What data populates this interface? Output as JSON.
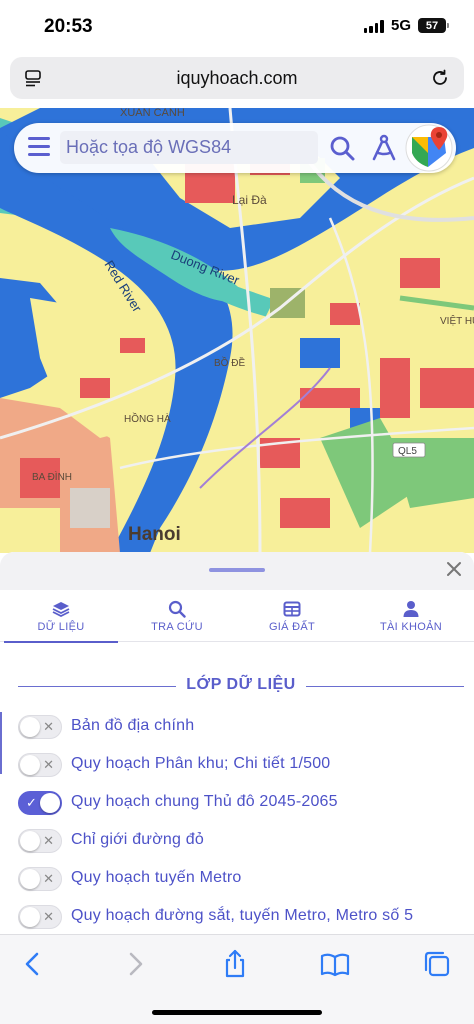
{
  "status_bar": {
    "time": "20:53",
    "network": "5G",
    "battery": "57",
    "signal_icon": "signal-bars-icon"
  },
  "browser": {
    "url": "iquyhoach.com",
    "left_icon": "page-menu-icon",
    "reload_icon": "reload-icon"
  },
  "map": {
    "labels": {
      "xuan_canh": "XUÂN CANH",
      "lai_da": "Lại Đà",
      "red_river": "Red River",
      "duong_river": "Duong River",
      "bo_de": "BỒ ĐỀ",
      "viet_hung": "VIỆT HƯ",
      "hong_ha": "HỒNG HÀ",
      "ba_dinh": "BA ĐÌNH",
      "ql5": "QL5",
      "hanoi": "Hanoi"
    },
    "colors": {
      "water": "#2e73d9",
      "floodplain": "#58c9b9",
      "residential": "#f7ef9a",
      "commercial": "#e65a5a",
      "park": "#7ec87a",
      "road": "#f0f0f0"
    }
  },
  "search": {
    "placeholder": "Hoặc tọa độ WGS84",
    "menu_icon": "hamburger-menu-icon",
    "search_icon": "search-icon",
    "measure_icon": "compass-measure-icon",
    "maps_icon": "google-maps-icon"
  },
  "sheet": {
    "tabs": [
      {
        "label": "DỮ LIỆU",
        "icon": "layers-icon",
        "active": true
      },
      {
        "label": "TRA CỨU",
        "icon": "search-icon",
        "active": false
      },
      {
        "label": "GIÁ ĐẤT",
        "icon": "table-grid-icon",
        "active": false
      },
      {
        "label": "TÀI KHOẢN",
        "icon": "user-icon",
        "active": false
      }
    ],
    "section_title": "LỚP DỮ LIỆU",
    "layers": [
      {
        "label": "Bản đồ địa chính",
        "enabled": false
      },
      {
        "label": "Quy hoạch Phân khu; Chi tiết 1/500",
        "enabled": false
      },
      {
        "label": "Quy hoạch chung Thủ đô 2045-2065",
        "enabled": true
      },
      {
        "label": "Chỉ giới đường đỏ",
        "enabled": false
      },
      {
        "label": "Quy hoạch tuyến Metro",
        "enabled": false
      },
      {
        "label": "Quy hoạch đường sắt, tuyến Metro, Metro số 5",
        "enabled": false
      }
    ],
    "toggle_off_mark": "✕",
    "toggle_on_mark": "✓"
  },
  "toolbar": {
    "buttons": [
      "back-icon",
      "forward-icon",
      "share-icon",
      "bookmarks-icon",
      "tabs-icon"
    ]
  }
}
